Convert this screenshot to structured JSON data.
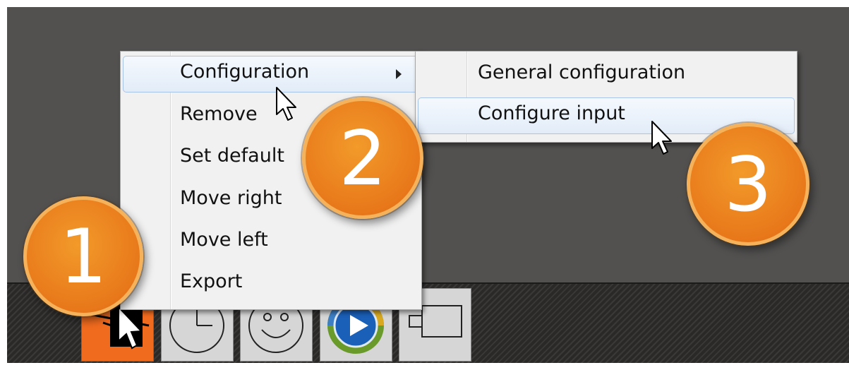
{
  "context_menu": {
    "items": [
      {
        "label": "Configuration",
        "has_submenu": true,
        "highlighted": true
      },
      {
        "label": "Remove"
      },
      {
        "label": "Set default"
      },
      {
        "label": "Move right"
      },
      {
        "label": "Move left"
      },
      {
        "label": "Export"
      }
    ]
  },
  "submenu": {
    "items": [
      {
        "label": "General configuration"
      },
      {
        "label": "Configure input",
        "highlighted": true
      }
    ]
  },
  "badges": [
    "1",
    "2",
    "3"
  ],
  "taskbar": {
    "icons": [
      "cursor-app-icon",
      "clock-icon",
      "smiley-icon",
      "media-player-icon",
      "window-icon"
    ]
  },
  "colors": {
    "badge_orange": "#e8781a",
    "desktop": "#525150",
    "selected_tile": "#f16b1e",
    "highlight_border": "#a8c5e8"
  }
}
